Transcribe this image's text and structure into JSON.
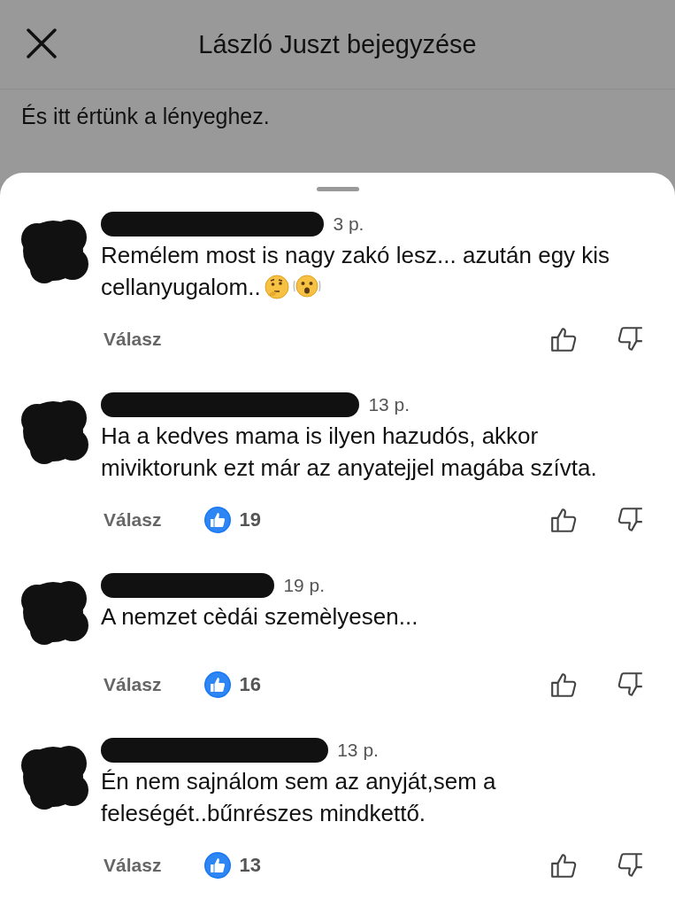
{
  "header": {
    "title": "László Juszt bejegyzése"
  },
  "post": {
    "lines": [
      "És itt értünk a lényeghez."
    ]
  },
  "comments": [
    {
      "time": "3 p.",
      "text": "Remélem most is nagy zakó lesz... azután egy kis cellanyugalom..",
      "emojis": [
        {
          "kind": "thinking"
        },
        {
          "kind": "shaking"
        }
      ],
      "reply": "Válasz"
    },
    {
      "time": "13 p.",
      "text": "Ha a kedves mama is ilyen hazudós, akkor miviktorunk ezt már az anyatejjel magába szívta.",
      "reply": "Válasz",
      "likes": "19"
    },
    {
      "time": "19 p.",
      "text": "A nemzet cèdái szemèlyesen...",
      "reply": "Válasz",
      "likes": "16"
    },
    {
      "time": "13 p.",
      "text": "Én nem sajnálom sem az anyját,sem a feleségét..bűnrészes mindkettő.",
      "reply": "Válasz",
      "likes": "13"
    }
  ]
}
